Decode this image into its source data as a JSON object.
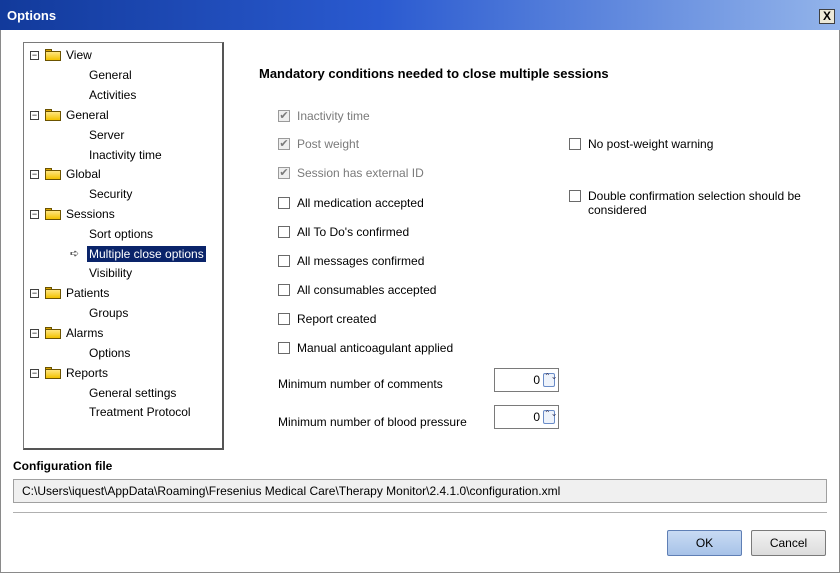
{
  "window": {
    "title": "Options",
    "close_glyph": "X"
  },
  "tree": {
    "groups": [
      {
        "label": "View",
        "expander": "−",
        "children": [
          "General",
          "Activities"
        ]
      },
      {
        "label": "General",
        "expander": "−",
        "children": [
          "Server",
          "Inactivity time"
        ]
      },
      {
        "label": "Global",
        "expander": "−",
        "children": [
          "Security"
        ]
      },
      {
        "label": "Sessions",
        "expander": "−",
        "children": [
          "Sort options",
          "Multiple close options",
          "Visibility"
        ]
      },
      {
        "label": "Patients",
        "expander": "−",
        "children": [
          "Groups"
        ]
      },
      {
        "label": "Alarms",
        "expander": "−",
        "children": [
          "Options"
        ]
      },
      {
        "label": "Reports",
        "expander": "−",
        "children": [
          "General settings",
          "Treatment Protocol"
        ]
      }
    ],
    "selected": "Multiple close options",
    "selected_arrow": "➪"
  },
  "main": {
    "heading": "Mandatory conditions needed to close multiple sessions",
    "checkboxes": {
      "inactivity_time": {
        "label": "Inactivity time",
        "checked": true,
        "enabled": false,
        "mark": "✔"
      },
      "post_weight": {
        "label": "Post weight",
        "checked": true,
        "enabled": false,
        "mark": "✔"
      },
      "session_external_id": {
        "label": "Session has external ID",
        "checked": true,
        "enabled": false,
        "mark": "✔"
      },
      "all_medication": {
        "label": "All medication accepted",
        "checked": false
      },
      "all_todos": {
        "label": "All To Do's confirmed",
        "checked": false
      },
      "all_messages": {
        "label": "All messages confirmed",
        "checked": false
      },
      "all_consumables": {
        "label": "All consumables accepted",
        "checked": false
      },
      "report_created": {
        "label": "Report created",
        "checked": false
      },
      "manual_anticoagulant": {
        "label": "Manual anticoagulant applied",
        "checked": false
      },
      "no_post_weight_warning": {
        "label": "No post-weight warning",
        "checked": false
      },
      "double_confirmation": {
        "label": "Double confirmation selection should be considered",
        "checked": false
      }
    },
    "min_comments": {
      "label": "Minimum number of comments",
      "value": "0"
    },
    "min_blood_pressure": {
      "label": "Minimum number of blood pressure",
      "value": "0"
    },
    "spinner_glyph": "⌃⌄"
  },
  "config": {
    "label": "Configuration file",
    "path": "C:\\Users\\iquest\\AppData\\Roaming\\Fresenius Medical Care\\Therapy Monitor\\2.4.1.0\\configuration.xml"
  },
  "buttons": {
    "ok": "OK",
    "cancel": "Cancel"
  },
  "colors": {
    "title_bar": "#123a9b",
    "selection": "#0a246a"
  }
}
